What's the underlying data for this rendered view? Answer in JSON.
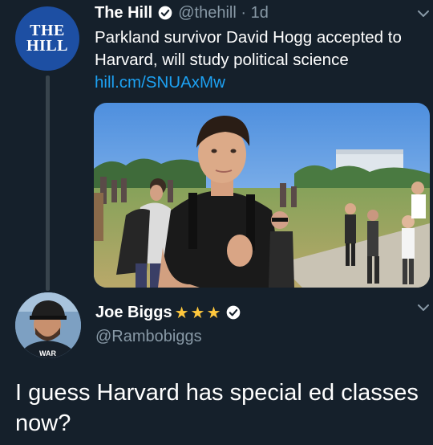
{
  "colors": {
    "background": "#15202b",
    "link": "#1da1f2",
    "secondary_text": "#8899a6",
    "hill_brand": "#1d4fa3",
    "stars": "#ffc83d"
  },
  "tweet": {
    "avatar_text_line1": "THE",
    "avatar_text_line2": "HILL",
    "name": "The Hill",
    "verified_icon": "verified-badge-icon",
    "handle_time": "@thehill · 1d",
    "text": "Parkland survivor David Hogg accepted to Harvard, will study political science",
    "link": "hill.cm/SNUAxMw",
    "menu_icon": "chevron-down-icon"
  },
  "reply": {
    "name": "Joe Biggs",
    "stars": "★★★",
    "verified_icon": "verified-badge-icon",
    "handle": "@Rambobiggs",
    "text": "I guess Harvard has special ed classes now?",
    "menu_icon": "chevron-down-icon",
    "avatar_shirt_text": "WAR"
  }
}
